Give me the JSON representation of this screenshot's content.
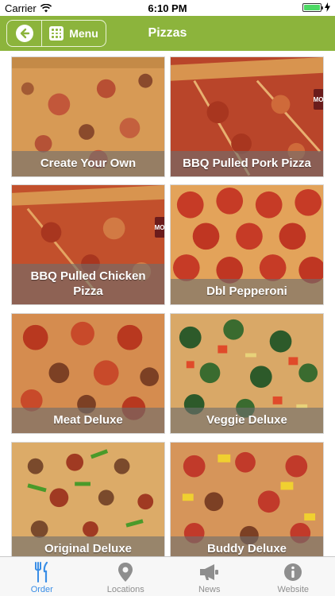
{
  "status_bar": {
    "carrier": "Carrier",
    "time": "6:10 PM"
  },
  "nav": {
    "menu_label": "Menu",
    "title": "Pizzas"
  },
  "pizzas": [
    {
      "name": "Create Your Own"
    },
    {
      "name": "BBQ Pulled Pork Pizza"
    },
    {
      "name": "BBQ Pulled Chicken Pizza"
    },
    {
      "name": "Dbl Pepperoni"
    },
    {
      "name": "Meat Deluxe"
    },
    {
      "name": "Veggie Deluxe"
    },
    {
      "name": "Original Deluxe"
    },
    {
      "name": "Buddy Deluxe"
    }
  ],
  "tabs": [
    {
      "label": "Order",
      "icon": "fork-knife-icon",
      "active": true
    },
    {
      "label": "Locations",
      "icon": "map-pin-icon",
      "active": false
    },
    {
      "label": "News",
      "icon": "megaphone-icon",
      "active": false
    },
    {
      "label": "Website",
      "icon": "info-icon",
      "active": false
    }
  ],
  "colors": {
    "brand_green": "#8cb43c",
    "tab_active": "#3a8ee6",
    "tab_inactive": "#8e8e8e",
    "caption_overlay": "#6e6e6e"
  }
}
